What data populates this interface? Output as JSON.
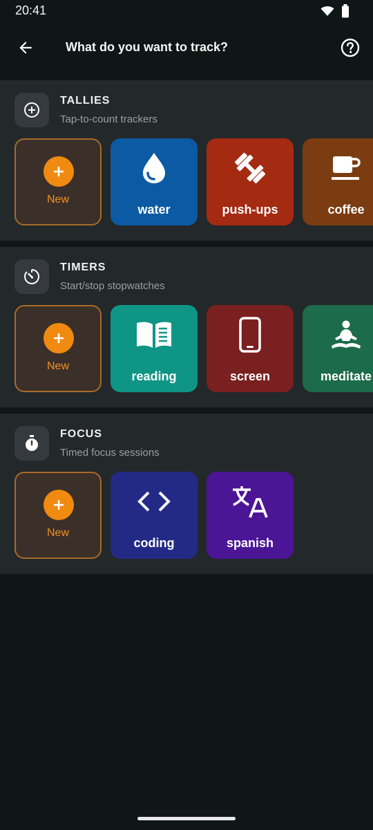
{
  "status": {
    "time": "20:41"
  },
  "header": {
    "title": "What do you want to track?"
  },
  "sections": [
    {
      "title": "TALLIES",
      "subtitle": "Tap-to-count trackers",
      "icon": "plus-circle-outline-icon",
      "new_label": "New",
      "items": [
        {
          "label": "water",
          "color": "#0b5aa3",
          "icon": "water-drop-icon"
        },
        {
          "label": "push-ups",
          "color": "#a52a12",
          "icon": "dumbbell-icon"
        },
        {
          "label": "coffee",
          "color": "#7a3c10",
          "icon": "coffee-cup-icon"
        }
      ]
    },
    {
      "title": "TIMERS",
      "subtitle": "Start/stop stopwatches",
      "icon": "timer-icon",
      "new_label": "New",
      "items": [
        {
          "label": "reading",
          "color": "#0e9585",
          "icon": "book-icon"
        },
        {
          "label": "screen",
          "color": "#7a2020",
          "icon": "phone-icon"
        },
        {
          "label": "meditate",
          "color": "#1c6b4a",
          "icon": "meditation-icon"
        }
      ]
    },
    {
      "title": "FOCUS",
      "subtitle": "Timed focus sessions",
      "icon": "stopwatch-icon",
      "new_label": "New",
      "items": [
        {
          "label": "coding",
          "color": "#232a86",
          "icon": "code-icon"
        },
        {
          "label": "spanish",
          "color": "#4b1596",
          "icon": "translate-icon"
        }
      ]
    }
  ],
  "colors": {
    "accent": "#f08a10",
    "background": "#0f1716",
    "section": "#23282a"
  }
}
